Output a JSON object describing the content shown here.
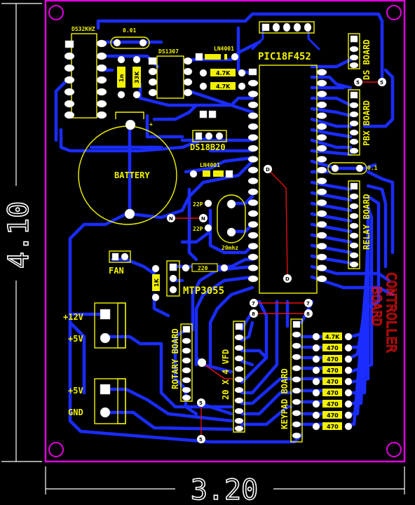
{
  "board": {
    "outline_color": "#e000e0",
    "trace_color": "#1a2cff",
    "silk_color": "#f2f200",
    "width_label": "3.20",
    "height_label": "4.10",
    "title": "CONTROLLER\nBOARD"
  },
  "labels": {
    "ds32khz": "DS32KHZ",
    "cap_top": "0.01",
    "ds1307": "DS1307",
    "ln4001_top": "LN4001",
    "pic": "PIC18F452",
    "ds_board": "DS BOARD",
    "pbx_board": "PBX BOARD",
    "relay_board": "RELAY BOARD",
    "ds18b20": "DS18B20",
    "ln4001_mid": "LN4001",
    "battery": "BATTERY",
    "cap_22p_a": "22P",
    "cap_22p_b": "22P",
    "crystal": "20mhz",
    "fan": "FAN",
    "mtp": "MTP3055",
    "plus12v": "+12V",
    "plus5v_a": "+5V",
    "plus5v_b": "+5V",
    "gnd": "GND",
    "rotary_board": "ROTARY BOARD",
    "vfd": "20 X 4 VFD",
    "keypad_board": "KEYPAD BOARD",
    "cap_right": "0.1",
    "controller": "CONTROLLER",
    "board_word": "BOARD"
  },
  "resistors": {
    "r_1n": "1n",
    "r_33k": "33K",
    "r_4k7_a": "4.7K",
    "r_4k7_b": "4.7K",
    "r_1k": "1K",
    "r_220": "220",
    "keypad_col": [
      "4.7K",
      "470",
      "470",
      "470",
      "470",
      "470",
      "470",
      "470",
      "470"
    ]
  },
  "vias": {
    "v5_top": "5",
    "v5_top2": "5",
    "vD_a": "D",
    "vD_b": "D",
    "vN_a": "N",
    "vN_b": "N",
    "v7_a": "7",
    "v7_b": "7",
    "v8_a": "8",
    "v8_b": "8",
    "v5_bot": "5",
    "v5_bot2": "5"
  }
}
